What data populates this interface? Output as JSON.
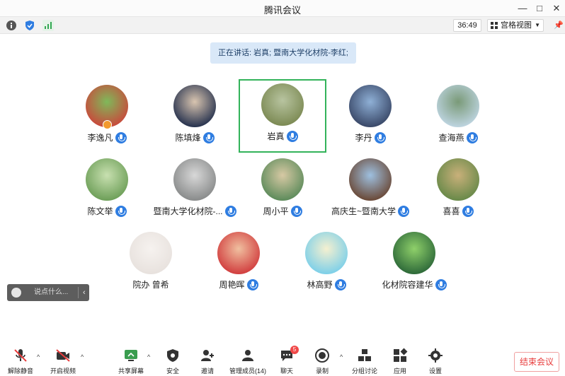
{
  "window": {
    "title": "腾讯会议",
    "minimize": "—",
    "maximize": "□",
    "close": "✕"
  },
  "toolbar": {
    "timer": "36:49",
    "view_mode": "宫格视图",
    "pin": "📌"
  },
  "speaking_banner": "正在讲话: 岩真; 暨南大学化材院-李红;",
  "participants": [
    {
      "name": "李逸凡",
      "host": true
    },
    {
      "name": "陈填烽"
    },
    {
      "name": "岩真",
      "active": true
    },
    {
      "name": "李丹"
    },
    {
      "name": "查海燕"
    },
    {
      "name": "陈文举"
    },
    {
      "name": "暨南大学化材院-..."
    },
    {
      "name": "周小平"
    },
    {
      "name": "高庆生~暨南大学"
    },
    {
      "name": "喜喜"
    },
    {
      "name": "院办 曾希",
      "muted_icon": false
    },
    {
      "name": "周艳晖"
    },
    {
      "name": "林高野"
    },
    {
      "name": "化材院容建华"
    }
  ],
  "chat_tip": {
    "placeholder": "说点什么..."
  },
  "bottom": {
    "unmute": "解除静音",
    "video": "开启视频",
    "share": "共享屏幕",
    "security": "安全",
    "invite": "邀请",
    "members": "管理成员(14)",
    "chat": "聊天",
    "chat_badge": "5",
    "record": "录制",
    "breakout": "分组讨论",
    "apps": "应用",
    "settings": "设置",
    "end": "结束会议"
  },
  "colors": {
    "accent": "#2f7de1",
    "active_border": "#33b35a",
    "end": "#e83c3c"
  }
}
